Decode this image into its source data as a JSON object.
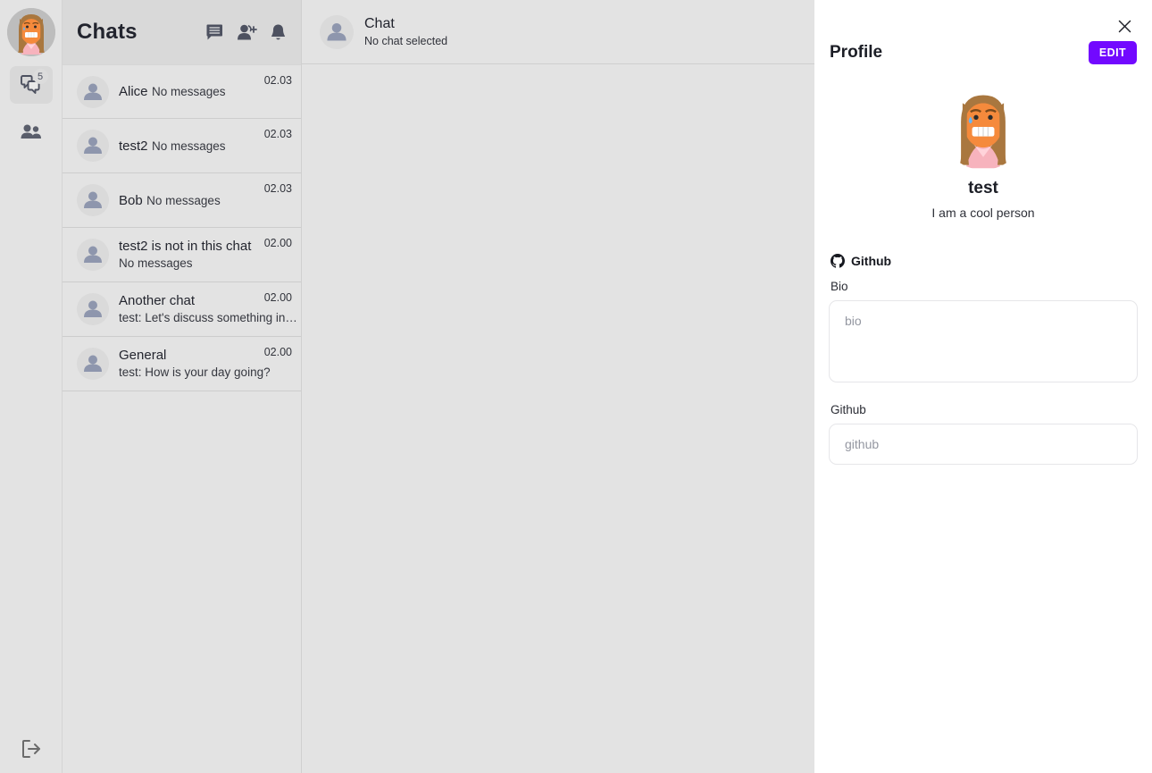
{
  "rail": {
    "avatar_name": "user-avatar",
    "chats_badge": "5",
    "items": [
      {
        "icon": "chats-icon",
        "badge": "5",
        "active": true
      },
      {
        "icon": "contacts-icon",
        "badge": "",
        "active": false
      }
    ],
    "logout_icon": "logout-icon"
  },
  "chat_list": {
    "title": "Chats",
    "header_icons": [
      "new-message-icon",
      "add-contact-icon",
      "notifications-icon"
    ],
    "items": [
      {
        "name": "Alice",
        "preview": "No messages",
        "time": "02.03"
      },
      {
        "name": "test2",
        "preview": "No messages",
        "time": "02.03"
      },
      {
        "name": "Bob",
        "preview": "No messages",
        "time": "02.03"
      },
      {
        "name": "test2 is not in this chat",
        "preview": "No messages",
        "time": "02.00"
      },
      {
        "name": "Another chat",
        "preview": "test: Let's discuss something in…",
        "time": "02.00"
      },
      {
        "name": "General",
        "preview": "test: How is your day going?",
        "time": "02.00"
      }
    ]
  },
  "chat_panel": {
    "title": "Chat",
    "subtitle": "No chat selected"
  },
  "profile": {
    "title": "Profile",
    "edit_label": "EDIT",
    "close_icon": "close-icon",
    "name": "test",
    "tagline": "I am a cool person",
    "section": {
      "icon": "github-icon",
      "label": "Github"
    },
    "fields": [
      {
        "label": "Bio",
        "value": "",
        "placeholder": "bio",
        "type": "textarea"
      },
      {
        "label": "Github",
        "value": "",
        "placeholder": "github",
        "type": "input"
      }
    ]
  },
  "colors": {
    "accent": "#7209ff",
    "app_bg": "#e3e3e3",
    "header_bg": "#d9d9d9",
    "panel_bg": "#ffffff",
    "icon": "#4d5160"
  }
}
